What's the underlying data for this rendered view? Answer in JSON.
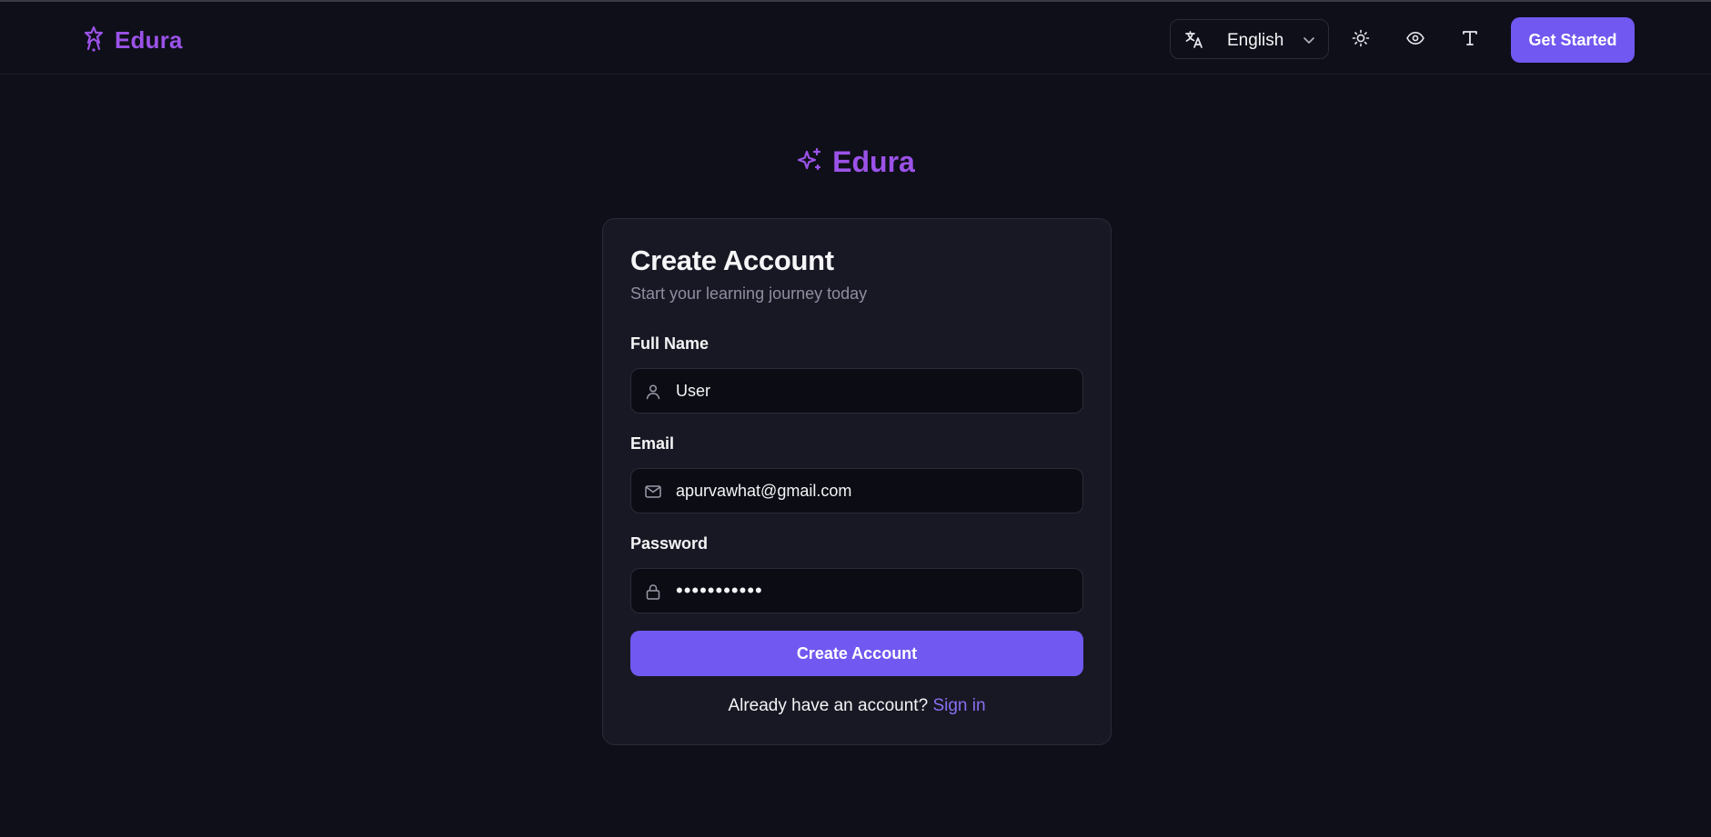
{
  "header": {
    "brand": "Edura",
    "language": "English",
    "cta_label": "Get Started"
  },
  "hero": {
    "brand": "Edura"
  },
  "form": {
    "title": "Create Account",
    "subtitle": "Start your learning journey today",
    "full_name": {
      "label": "Full Name",
      "value": "User"
    },
    "email": {
      "label": "Email",
      "value": "apurvawhat@gmail.com"
    },
    "password": {
      "label": "Password",
      "value": "•••••••••••"
    },
    "submit_label": "Create Account",
    "signin_prompt": "Already have an account?",
    "signin_link": "Sign in"
  },
  "colors": {
    "background": "#0e0f19",
    "card": "#181824",
    "brand": "#9b52e8",
    "accent": "#7058f0"
  },
  "icons": {
    "brand": "star-person-icon",
    "hero": "sparkles-icon",
    "language": "translate-icon",
    "theme": "sun-icon",
    "accessibility": "eye-icon",
    "font_size": "type-icon",
    "name_field": "user-icon",
    "email_field": "mail-icon",
    "password_field": "lock-icon"
  }
}
